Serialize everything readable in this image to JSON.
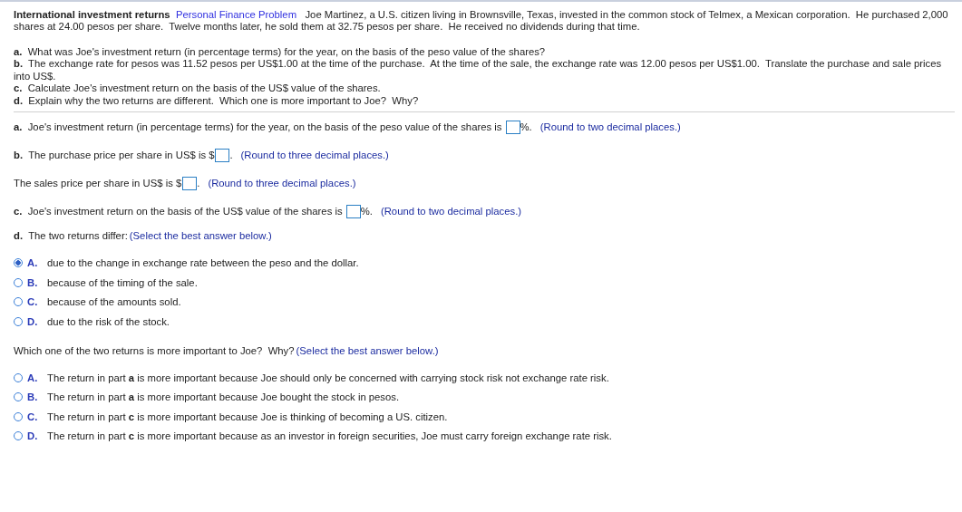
{
  "problem": {
    "title": "International investment returns",
    "tag": "Personal Finance Problem",
    "text": "Joe Martinez, a U.S. citizen living in Brownsville, Texas, invested in the common stock of Telmex, a Mexican corporation.  He purchased 2,000 shares at 24.00 pesos per share.  Twelve months later, he sold them at 32.75 pesos per share.  He received no dividends during that time."
  },
  "questions": [
    {
      "letter": "a.",
      "text": "What was Joe's investment return (in percentage terms) for the year, on the basis of the peso value of the shares?"
    },
    {
      "letter": "b.",
      "text": "The exchange rate for pesos was 11.52 pesos per US$1.00 at the time of the purchase.  At the time of the sale, the exchange rate was 12.00 pesos per US$1.00.  Translate the purchase and sale prices into US$."
    },
    {
      "letter": "c.",
      "text": "Calculate Joe's investment return on the basis of the US$ value of the shares."
    },
    {
      "letter": "d.",
      "text": "Explain why the two returns are different.  Which one is more important to Joe?  Why?"
    }
  ],
  "answers": [
    {
      "letter": "a.",
      "text": "Joe's investment return (in percentage terms) for the year, on the basis of the peso value of the shares is",
      "suffix": "%.",
      "hint": "(Round to two decimal places.)"
    },
    {
      "letter": "b.",
      "text": "The purchase price per share in US$ is",
      "prefix": "$",
      "suffix": ".",
      "hint": "(Round to three decimal places.)"
    },
    {
      "text": "The sales price per share in US$ is",
      "prefix": "$",
      "suffix": ".",
      "hint": "(Round to three decimal places.)"
    },
    {
      "letter": "c.",
      "text": "Joe's investment return on the basis of the US$ value of the shares is",
      "suffix": "%.",
      "hint": "(Round to two decimal places.)"
    }
  ],
  "choice_groups": [
    {
      "letter": "d.",
      "prompt": "The two returns differ:",
      "hint": "(Select the best answer below.)",
      "options": [
        {
          "letter": "A.",
          "text": "due to the change in exchange rate between the peso and the dollar.",
          "selected": true
        },
        {
          "letter": "B.",
          "text": "because of the timing of the sale.",
          "selected": false
        },
        {
          "letter": "C.",
          "text": "because of the amounts sold.",
          "selected": false
        },
        {
          "letter": "D.",
          "text": "due to the risk of the stock.",
          "selected": false
        }
      ]
    },
    {
      "prompt": "Which one of the two returns is more important to Joe?  Why?",
      "hint": "(Select the best answer below.)",
      "options": [
        {
          "letter": "A.",
          "text": "The return in part **a** is more important because Joe should only be concerned with carrying stock risk not exchange rate risk.",
          "selected": false
        },
        {
          "letter": "B.",
          "text": "The return in part **a** is more important because Joe bought the stock in pesos.",
          "selected": false
        },
        {
          "letter": "C.",
          "text": "The return in part **c** is more important because Joe is thinking of becoming a US. citizen.",
          "selected": false
        },
        {
          "letter": "D.",
          "text": "The return in part **c** is more important because as an investor in foreign securities, Joe must carry foreign exchange rate risk.",
          "selected": false
        }
      ]
    }
  ]
}
